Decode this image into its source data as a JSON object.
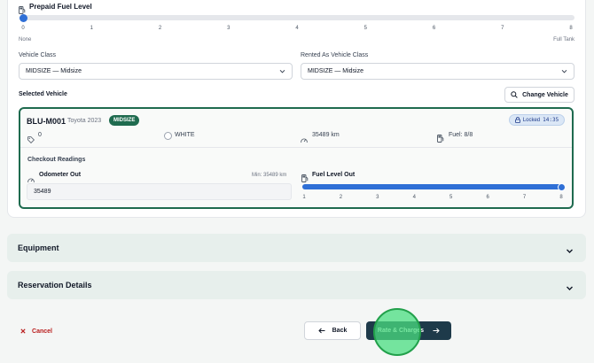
{
  "fuel": {
    "label": "Prepaid Fuel Level",
    "ticks": [
      "0",
      "1",
      "2",
      "3",
      "4",
      "5",
      "6",
      "7",
      "8"
    ],
    "min_caption": "None",
    "max_caption": "Full Tank",
    "level_fraction": 0
  },
  "vehicle_class": {
    "label": "Vehicle Class",
    "value": "MIDSIZE — Midsize"
  },
  "rented_as": {
    "label": "Rented As Vehicle Class",
    "value": "MIDSIZE — Midsize"
  },
  "selected_vehicle": {
    "label": "Selected Vehicle",
    "change_button": "Change Vehicle",
    "unit": "BLU-M001",
    "make": "Toyota 2023",
    "class_badge": "MIDSIZE",
    "lock_label": "Locked",
    "lock_time": "14:35",
    "tag_value": "0",
    "color": "WHITE",
    "odometer": "35489 km",
    "fuel": "Fuel: 8/8"
  },
  "checkout": {
    "label": "Checkout Readings",
    "odometer_label": "Odometer Out",
    "odometer_min": "Min: 35489 km",
    "odometer_value": "35489",
    "fuel_label": "Fuel Level Out",
    "fuel_ticks": [
      "1",
      "2",
      "3",
      "4",
      "5",
      "6",
      "7",
      "8"
    ],
    "fuel_fraction": 1
  },
  "sections": {
    "equipment": "Equipment",
    "reservation": "Reservation Details"
  },
  "footer": {
    "cancel": "Cancel",
    "back": "Back",
    "next": "Rate & Charges"
  },
  "colors": {
    "accent_blue": "#2f6fd6",
    "brand_green": "#1f6b4f",
    "dark_button": "#1e3a4a",
    "cancel_red": "#b91c1c"
  }
}
